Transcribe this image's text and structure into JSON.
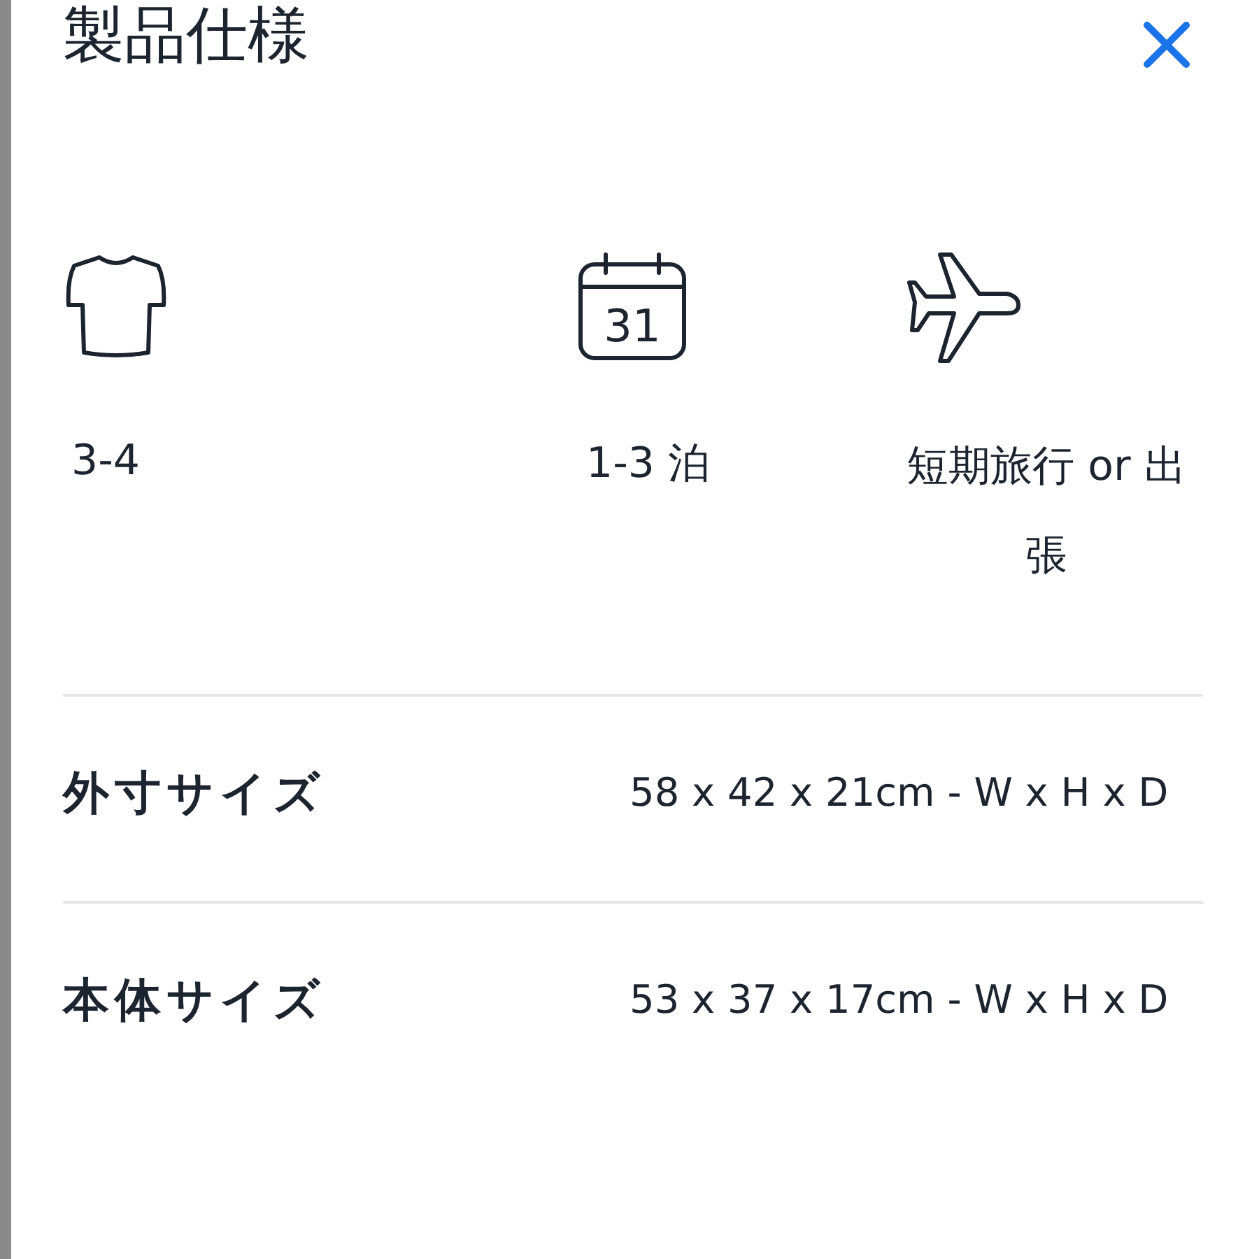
{
  "title": "製品仕様",
  "features": [
    {
      "kind": "shirt",
      "label": "3-4"
    },
    {
      "kind": "calendar",
      "day": "31",
      "label": "1-3 泊"
    },
    {
      "kind": "plane",
      "label": "短期旅行 or 出張"
    }
  ],
  "specs": [
    {
      "label": "外寸サイズ",
      "value": "58 x 42 x 21cm - W x H x D"
    },
    {
      "label": "本体サイズ",
      "value": "53 x 37 x 17cm - W x H x D"
    }
  ]
}
